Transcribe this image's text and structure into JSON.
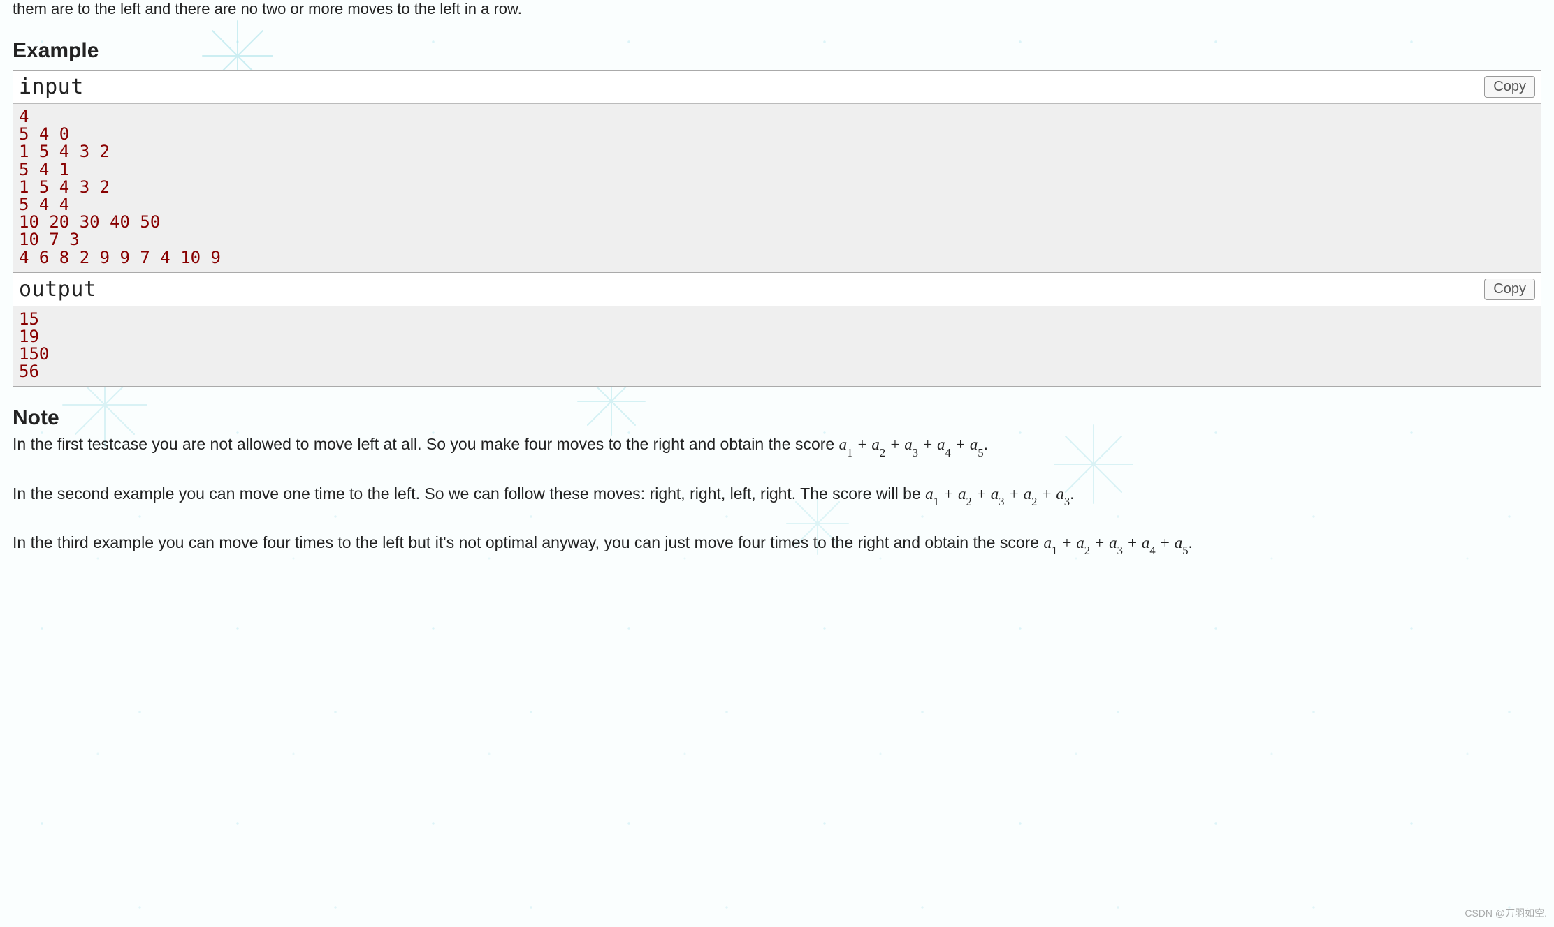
{
  "cutoff_line": "them are to the left and there are no two or more moves to the left in a row.",
  "headings": {
    "example": "Example",
    "note": "Note"
  },
  "io": {
    "input_label": "input",
    "output_label": "output",
    "copy_label": "Copy",
    "input_text": "4\n5 4 0\n1 5 4 3 2\n5 4 1\n1 5 4 3 2\n5 4 4\n10 20 30 40 50\n10 7 3\n4 6 8 2 9 9 7 4 10 9",
    "output_text": "15\n19\n150\n56"
  },
  "note": {
    "p1_intro": "In the first testcase you are not allowed to move left at all. So you make four moves to the right and obtain the score ",
    "p1_formula_terms": [
      "1",
      "2",
      "3",
      "4",
      "5"
    ],
    "p2_intro": "In the second example you can move one time to the left. So we can follow these moves: right, right, left, right. The score will be ",
    "p2_formula_terms": [
      "1",
      "2",
      "3",
      "2",
      "3"
    ],
    "p3_intro": "In the third example you can move four times to the left but it's not optimal anyway, you can just move four times to the right and obtain the score ",
    "p3_formula_terms": [
      "1",
      "2",
      "3",
      "4",
      "5"
    ]
  },
  "watermark": "CSDN @万羽如空."
}
